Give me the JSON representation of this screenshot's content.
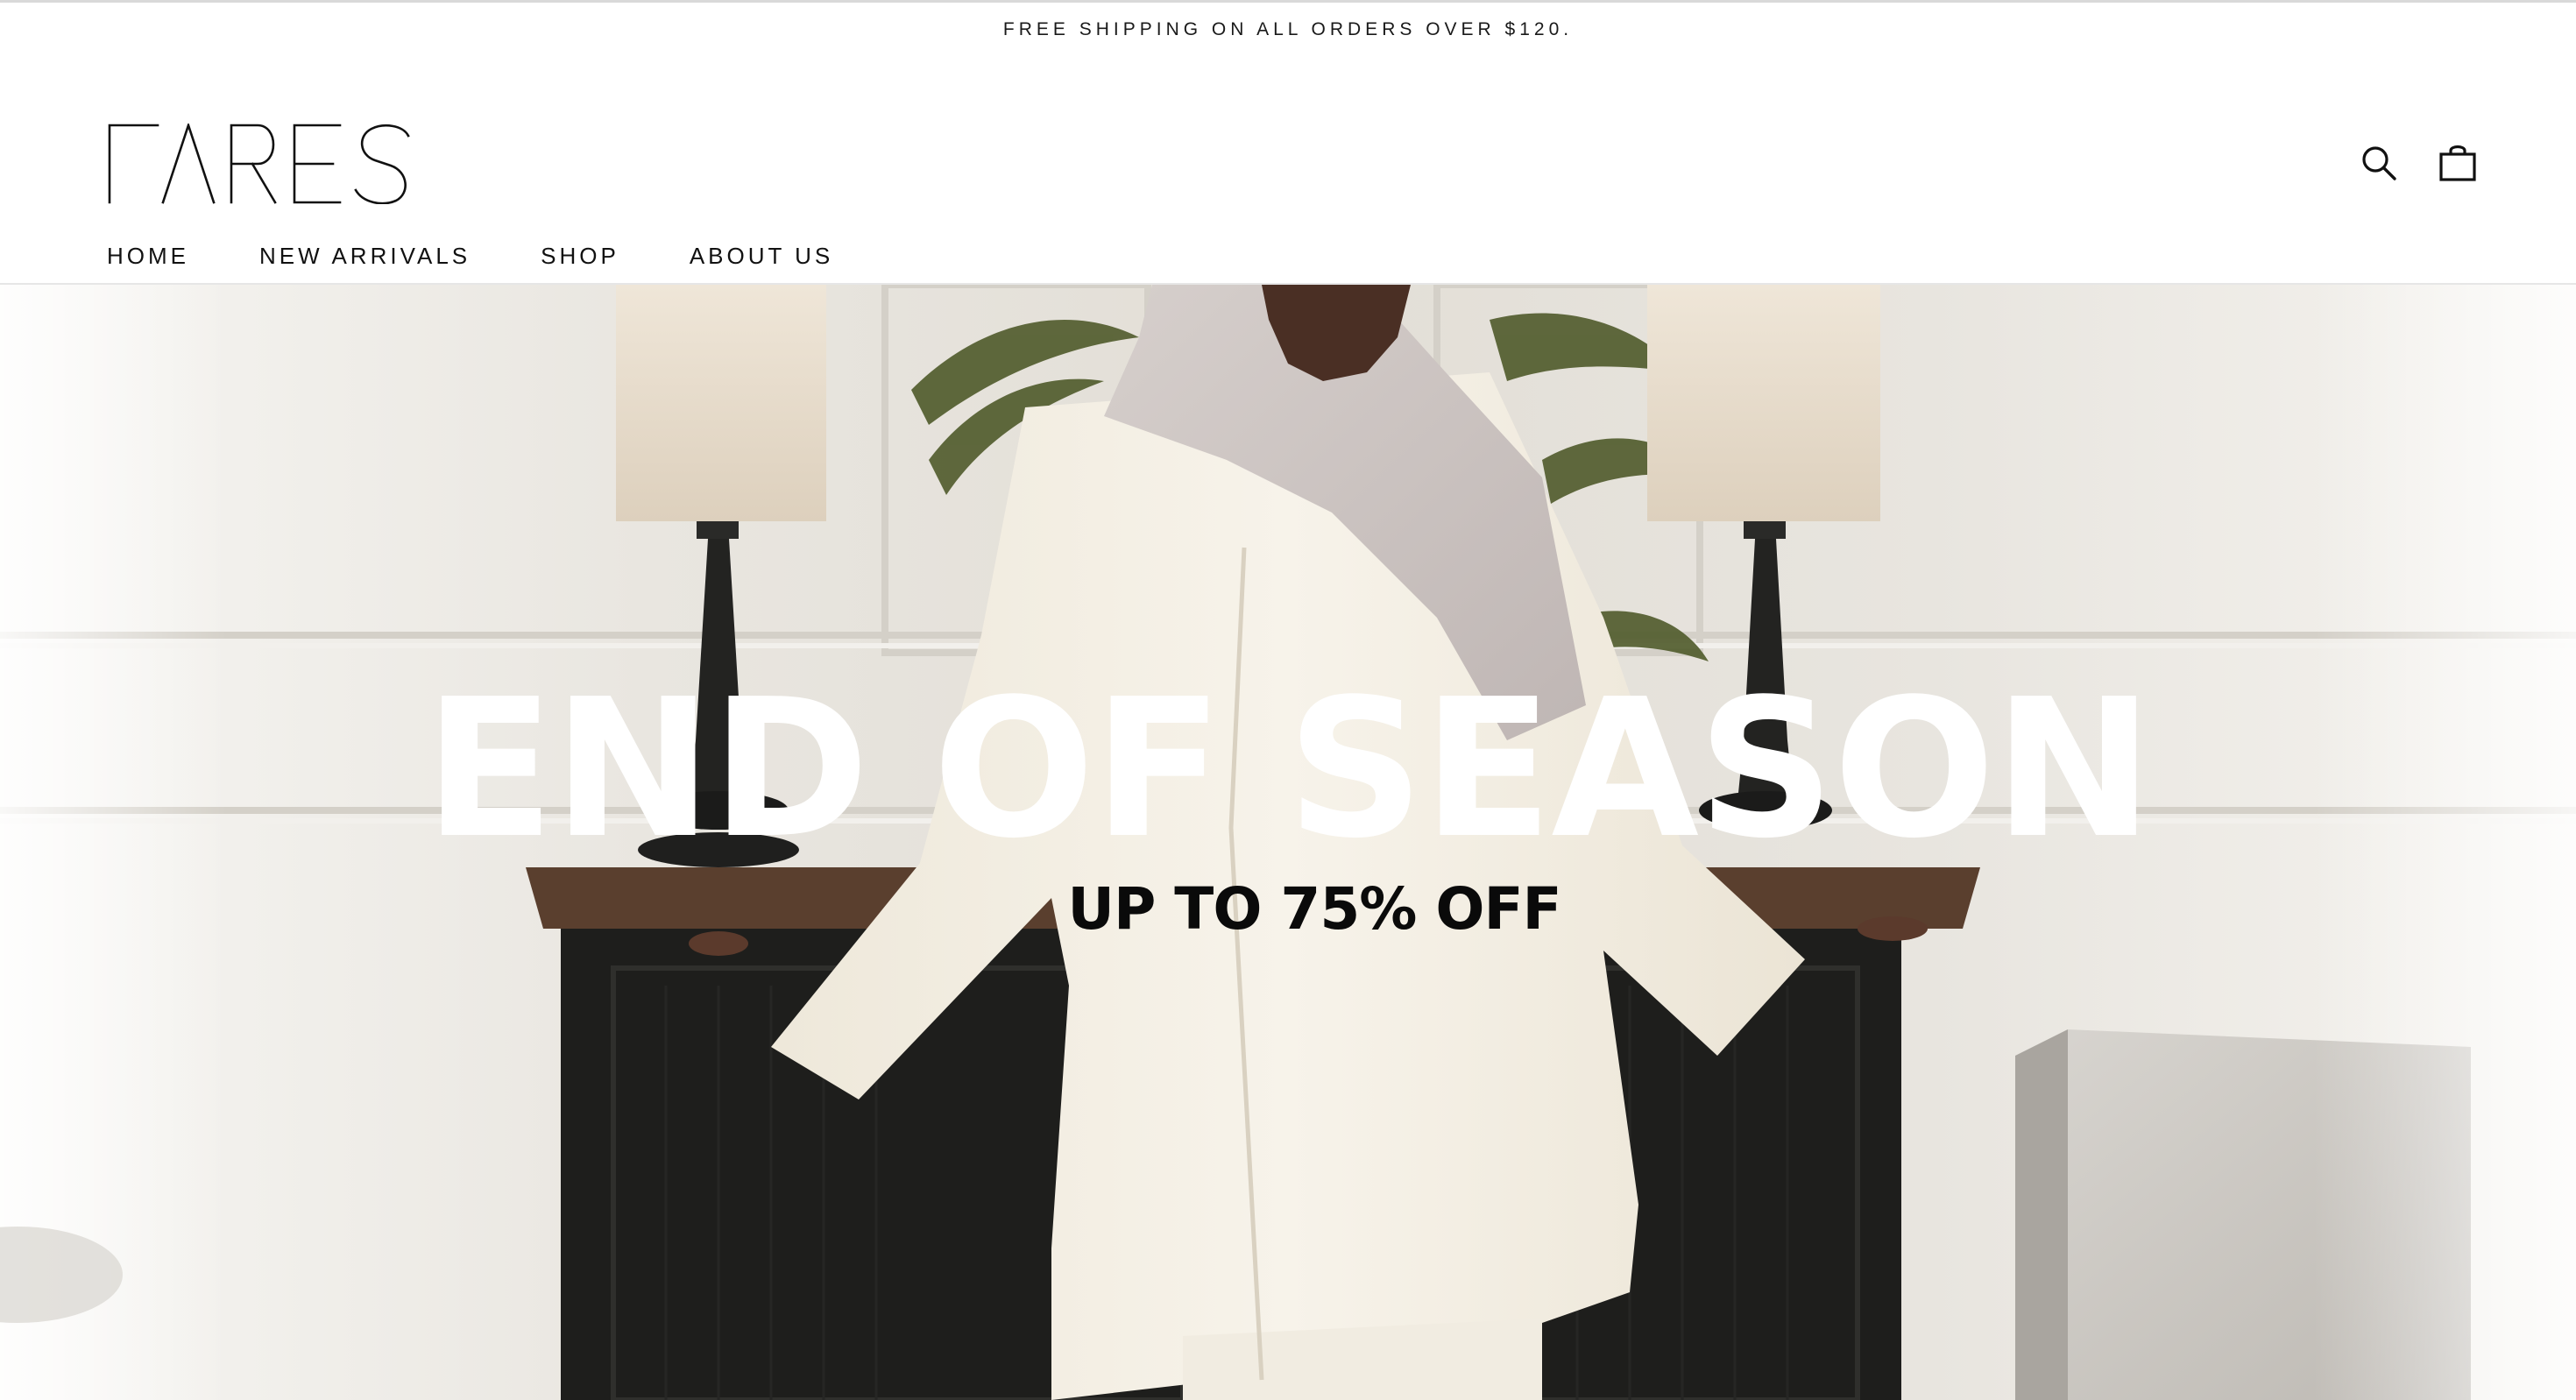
{
  "announcement": {
    "text": "FREE SHIPPING ON ALL ORDERS OVER $120."
  },
  "header": {
    "logo_text": "FARES",
    "icons": {
      "search": "search-icon",
      "cart": "shopping-bag-icon"
    }
  },
  "nav": {
    "items": [
      {
        "label": "HOME"
      },
      {
        "label": "NEW ARRIVALS"
      },
      {
        "label": "SHOP"
      },
      {
        "label": "ABOUT US"
      }
    ]
  },
  "hero": {
    "title": "END OF SEASON",
    "subtitle": "UP TO 75% OFF"
  },
  "colors": {
    "text": "#111111",
    "hero_title": "#ffffff",
    "hero_subtitle": "#0a0a0a",
    "background": "#ffffff"
  }
}
